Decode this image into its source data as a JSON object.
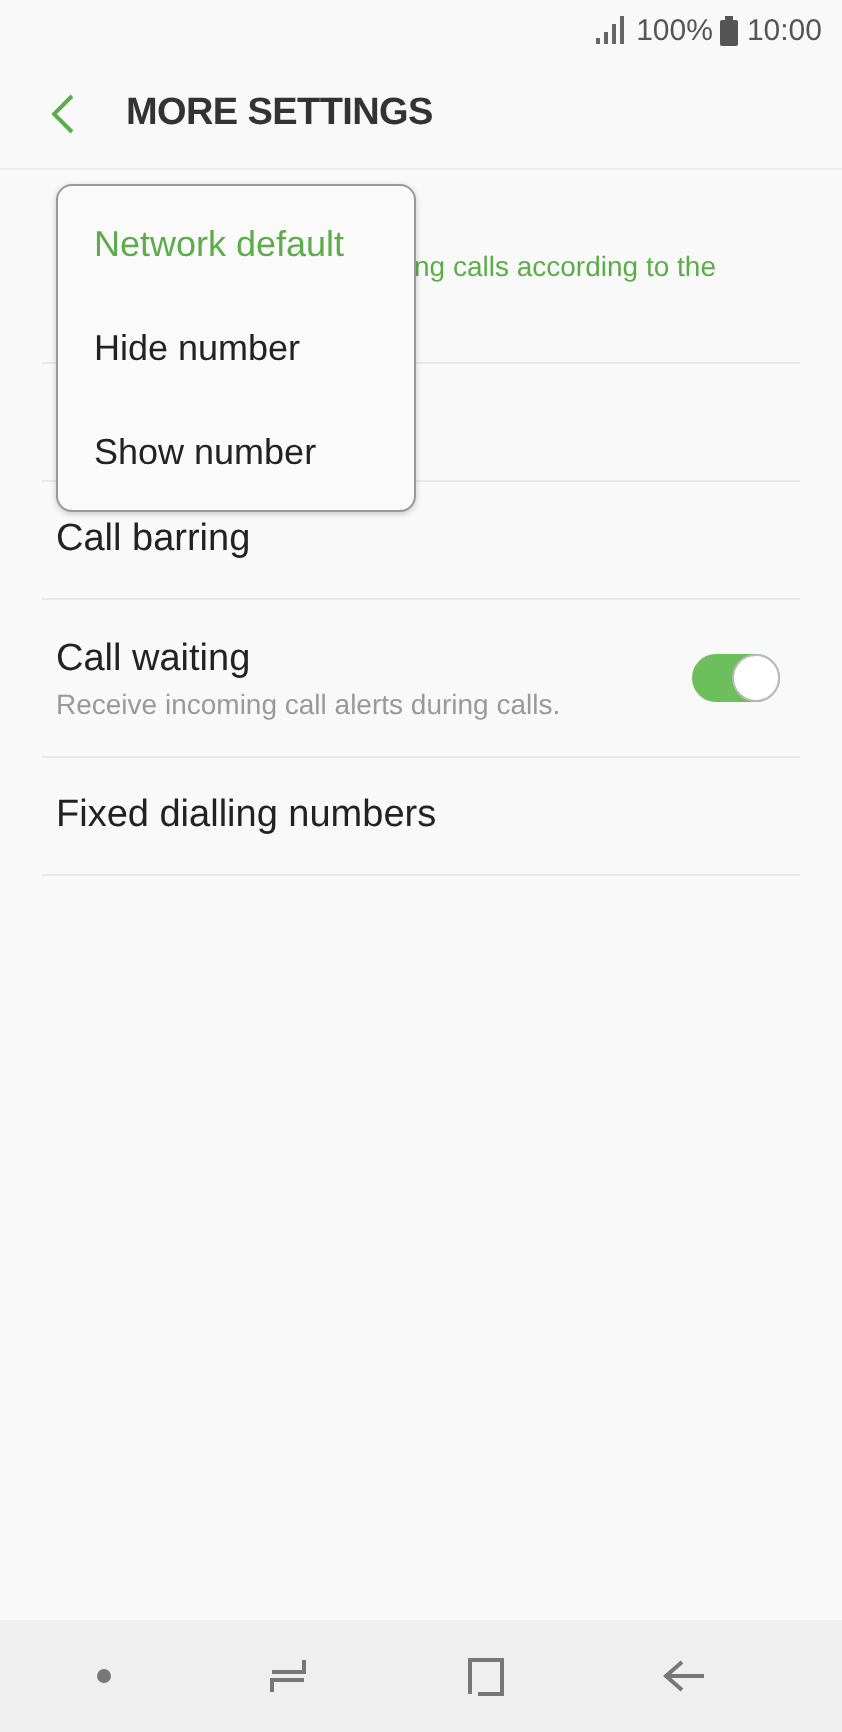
{
  "status_bar": {
    "battery": "100%",
    "time": "10:00"
  },
  "header": {
    "title": "MORE SETTINGS"
  },
  "rows": [
    {
      "kind": "partial",
      "subtitle": "ng calls according to the"
    },
    {
      "kind": "plain",
      "title": "Call barring"
    },
    {
      "kind": "switch",
      "title": "Call waiting",
      "subtitle": "Receive incoming call alerts during calls.",
      "on": true
    },
    {
      "kind": "plain",
      "title": "Fixed dialling numbers"
    }
  ],
  "menu": [
    {
      "label": "Network default",
      "selected": true
    },
    {
      "label": "Hide number",
      "selected": false
    },
    {
      "label": "Show number",
      "selected": false
    }
  ]
}
